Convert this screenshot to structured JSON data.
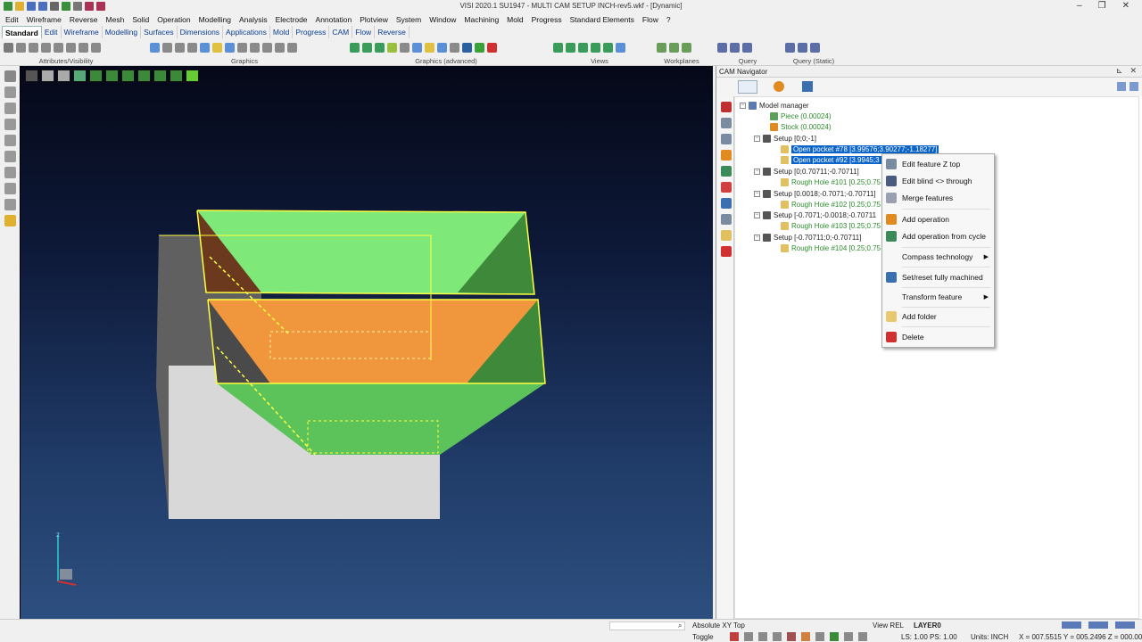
{
  "window": {
    "title": "VISI 2020.1 SU1947 - MULTI CAM SETUP INCH-rev5.wkf - [Dynamic]"
  },
  "menu": [
    "Edit",
    "Wireframe",
    "Reverse",
    "Mesh",
    "Solid",
    "Operation",
    "Modelling",
    "Analysis",
    "Electrode",
    "Annotation",
    "Plotview",
    "System",
    "Window",
    "Machining",
    "Mold",
    "Progress",
    "Standard Elements",
    "Flow",
    "?"
  ],
  "tabs": [
    "Standard",
    "Edit",
    "Wireframe",
    "Modelling",
    "Surfaces",
    "Dimensions",
    "Applications",
    "Mold",
    "Progress",
    "CAM",
    "Flow",
    "Reverse"
  ],
  "ribbon_groups": [
    "Attributes/Visibility",
    "Graphics",
    "Graphics (advanced)",
    "Views",
    "Workplanes",
    "Query",
    "Query (Static)"
  ],
  "cam_navigator": {
    "title": "CAM Navigator",
    "tree": {
      "root": "Model manager",
      "piece": "Piece (0.00024)",
      "stock": "Stock (0.00024)",
      "setup1": "Setup [0;0;-1]",
      "pocket1": "Open pocket #78 [3.99576;3.90277;-1.18277]",
      "pocket2": "Open pocket #92 [3.9945;3",
      "setup2": "Setup [0;0.70711;-0.70711]",
      "hole1": "Rough Hole #101 [0.25;0.75",
      "setup3": "Setup [0.0018;-0.7071;-0.70711]",
      "hole2": "Rough Hole #102 [0.25;0.75",
      "setup4": "Setup [-0.7071;-0.0018;-0.70711",
      "hole3": "Rough Hole #103 [0.25;0.75",
      "setup5": "Setup [-0.70711;0;-0.70711]",
      "hole4": "Rough Hole #104 [0.25;0.75"
    }
  },
  "context_menu": {
    "edit_z_top": "Edit feature Z top",
    "edit_blind": "Edit blind <> through",
    "merge": "Merge features",
    "add_operation": "Add operation",
    "add_operation_cycle": "Add operation from cycle",
    "compass": "Compass technology",
    "set_reset": "Set/reset fully machined",
    "transform": "Transform feature",
    "add_folder": "Add folder",
    "delete": "Delete"
  },
  "statusbar": {
    "workplane": "Absolute XY Top",
    "view_rel": "View REL",
    "layer": "LAYER0",
    "toggle": "Toggle",
    "ls_ps": "LS: 1.00 PS: 1.00",
    "units": "Units: INCH",
    "coords": "X = 007.5515 Y = 005.2496 Z = 000.0000"
  },
  "colors": {
    "green_face": "#5cc35a",
    "orange_face": "#f0963c",
    "selection": "#0a64c9"
  }
}
